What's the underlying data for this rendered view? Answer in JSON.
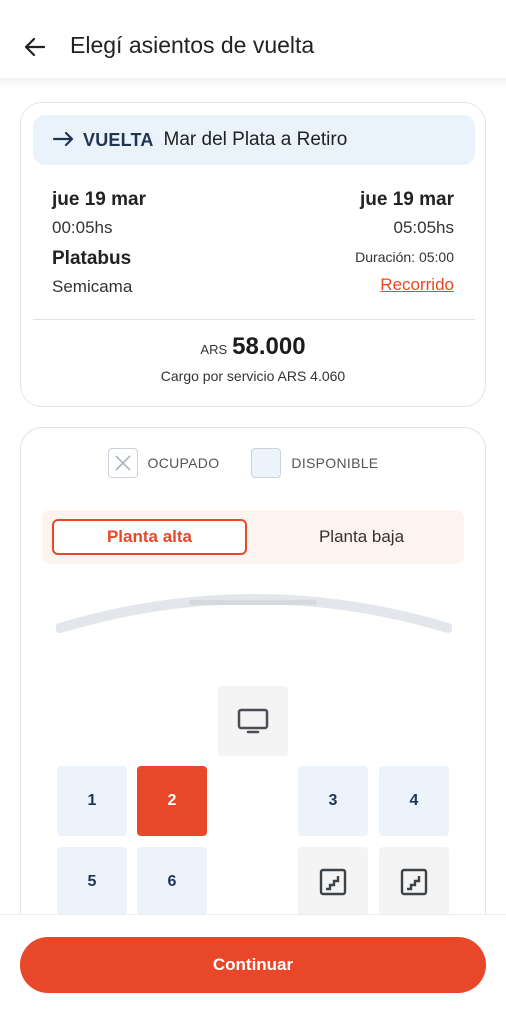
{
  "header": {
    "title": "Elegí asientos de vuelta",
    "back_icon": "arrow-left-icon"
  },
  "trip": {
    "direction_label": "VUELTA",
    "route": "Mar del Plata a Retiro",
    "departure_date": "jue 19 mar",
    "departure_time": "00:05hs",
    "arrival_date": "jue 19 mar",
    "arrival_time": "05:05hs",
    "company": "Platabus",
    "duration": "Duración: 05:00",
    "seat_type": "Semicama",
    "route_link": "Recorrido",
    "price_currency": "ARS",
    "price_amount": "58.000",
    "service_fee": "Cargo por servicio ARS 4.060"
  },
  "legend": {
    "occupied": "OCUPADO",
    "available": "DISPONIBLE"
  },
  "floors": {
    "upper": "Planta alta",
    "lower": "Planta baja",
    "selected": "Planta alta"
  },
  "seats": [
    {
      "number": "1",
      "state": "available"
    },
    {
      "number": "2",
      "state": "selected"
    },
    {
      "number": "3",
      "state": "available"
    },
    {
      "number": "4",
      "state": "available"
    },
    {
      "number": "5",
      "state": "available"
    },
    {
      "number": "6",
      "state": "available"
    }
  ],
  "facilities": [
    "tv-icon",
    "stairs-icon",
    "stairs-icon"
  ],
  "footer": {
    "continue_label": "Continuar"
  },
  "colors": {
    "accent": "#e8472a",
    "available_seat": "#edf3fa",
    "route_banner": "#eaf2fb",
    "floor_tabs_bg": "#fdf3ef"
  }
}
